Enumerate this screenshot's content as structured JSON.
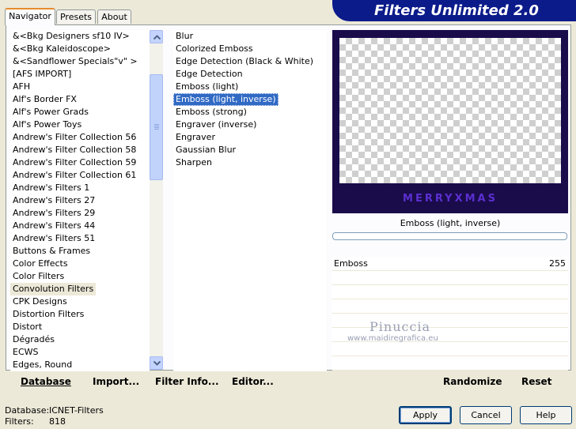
{
  "title": "Filters Unlimited 2.0",
  "tabs": [
    {
      "label": "Navigator",
      "active": true
    },
    {
      "label": "Presets",
      "active": false
    },
    {
      "label": "About",
      "active": false
    }
  ],
  "categories": [
    "&<Bkg Designers sf10 IV>",
    "&<Bkg Kaleidoscope>",
    "&<Sandflower Specials\"v\" >",
    "[AFS IMPORT]",
    "AFH",
    "Alf's Border FX",
    "Alf's Power Grads",
    "Alf's Power Toys",
    "Andrew's Filter Collection 56",
    "Andrew's Filter Collection 58",
    "Andrew's Filter Collection 59",
    "Andrew's Filter Collection 61",
    "Andrew's Filters 1",
    "Andrew's Filters 27",
    "Andrew's Filters 29",
    "Andrew's Filters 44",
    "Andrew's Filters 51",
    "Buttons & Frames",
    "Color Effects",
    "Color Filters",
    "Convolution Filters",
    "CPK Designs",
    "Distortion Filters",
    "Distort",
    "Dégradés",
    "ECWS",
    "Edges, Round"
  ],
  "selected_category": "Convolution Filters",
  "filters": [
    "Blur",
    "Colorized Emboss",
    "Edge Detection (Black & White)",
    "Edge Detection",
    "Emboss (light)",
    "Emboss (light, inverse)",
    "Emboss (strong)",
    "Engraver (inverse)",
    "Engraver",
    "Gaussian Blur",
    "Sharpen"
  ],
  "selected_filter": "Emboss (light, inverse)",
  "preview": {
    "text": "MERRYXMAS",
    "filter_label": "Emboss (light, inverse)"
  },
  "params": [
    {
      "name": "Emboss",
      "value": "255"
    }
  ],
  "bottom_left_buttons": [
    "Database",
    "Import...",
    "Filter Info...",
    "Editor..."
  ],
  "bottom_right_buttons": [
    "Randomize",
    "Reset"
  ],
  "info": {
    "database_label": "Database:",
    "database_value": "ICNET-Filters",
    "filters_label": "Filters:",
    "filters_value": "818"
  },
  "dialog_buttons": {
    "apply": "Apply",
    "cancel": "Cancel",
    "help": "Help"
  },
  "watermark": {
    "name": "Pinuccia",
    "site": "www.maidiregrafica.eu"
  },
  "colors": {
    "banner": "#0b1b8a",
    "selection": "#316ac5",
    "preview_bg": "#1a0b4a"
  }
}
